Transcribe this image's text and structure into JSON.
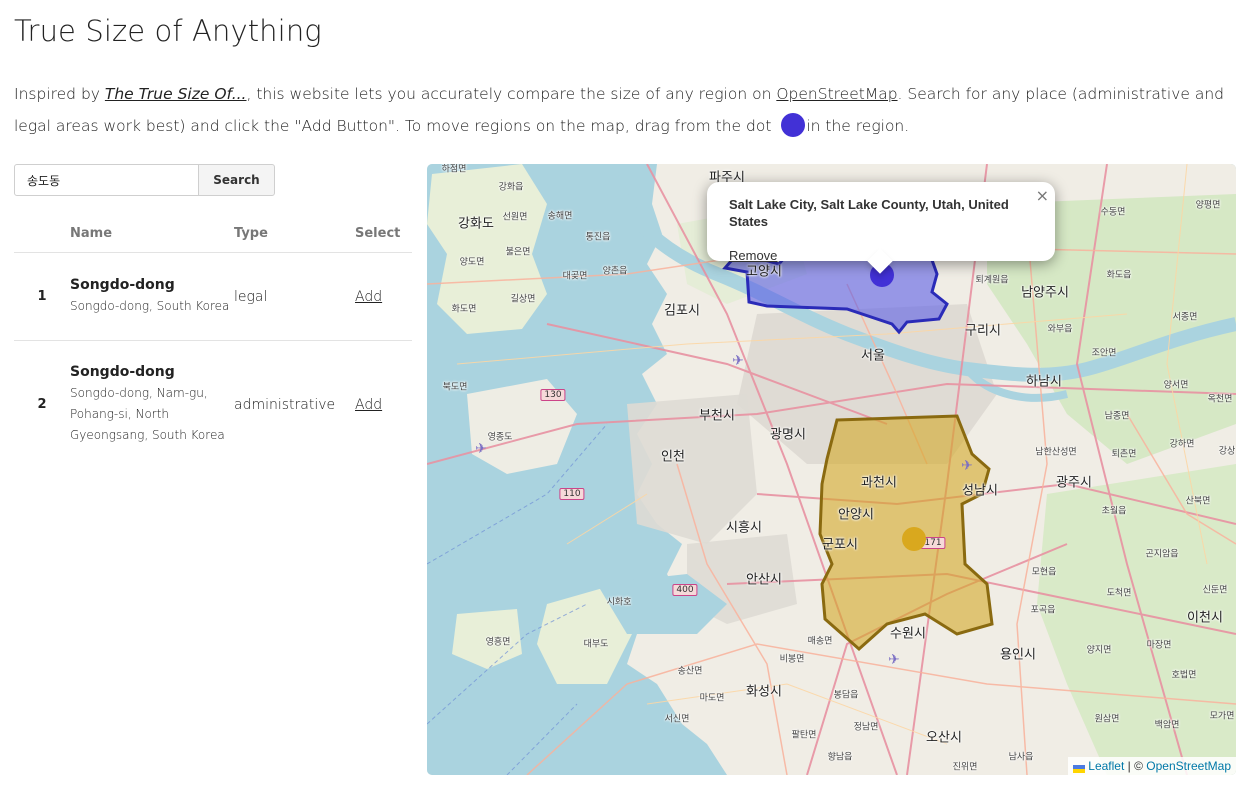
{
  "page": {
    "title": "True Size of Anything",
    "intro": {
      "part1": "Inspired by ",
      "link1": "The True Size Of...",
      "part2": ", this website lets you accurately compare the size of any region on ",
      "link2": "OpenStreetMap",
      "part3": ". Search for any place (administrative and legal areas work best) and click the \"Add Button\". To move regions on the map, drag from the dot ",
      "part4": "in the region."
    },
    "dot_color": "#4231d6"
  },
  "search": {
    "value": "송도동",
    "button_label": "Search"
  },
  "results": {
    "headers": [
      "",
      "Name",
      "Type",
      "Select"
    ],
    "rows": [
      {
        "index": "1",
        "name": "Songdo-dong",
        "description": "Songdo-dong, South Korea",
        "type": "legal",
        "action": "Add"
      },
      {
        "index": "2",
        "name": "Songdo-dong",
        "description": "Songdo-dong, Nam-gu, Pohang-si, North Gyeongsang, South Korea",
        "type": "administrative",
        "action": "Add"
      }
    ]
  },
  "map": {
    "popup": {
      "title": "Salt Lake City, Salt Lake County, Utah, United States",
      "remove_label": "Remove",
      "close_symbol": "×"
    },
    "regions": [
      {
        "name": "Salt Lake City",
        "fill": "#5b5ee6",
        "stroke": "#2a2bb8"
      },
      {
        "name": "region-yellow",
        "fill": "#d4a928",
        "stroke": "#8a6a10"
      }
    ],
    "labels": {
      "paju": "파주시",
      "goyang": "고양시",
      "gimpo": "김포시",
      "seoul": "서울",
      "guri": "구리시",
      "namyangju": "남양주시",
      "hanam": "하남시",
      "bucheon": "부천시",
      "gwangmyeong": "광명시",
      "incheon": "인천",
      "gwacheon": "과천시",
      "seongnam": "성남시",
      "gwangju": "광주시",
      "anyang": "안양시",
      "gunpo": "군포시",
      "siheung": "시흥시",
      "ansan": "안산시",
      "suwon": "수원시",
      "yongin": "용인시",
      "icheon": "이천시",
      "hwaseong": "화성시",
      "osan": "오산시",
      "ganghwa": "강화도",
      "sihwaho": "시화호",
      "daebu": "대부도",
      "ansan2": "안산시",
      "yeongjong": "영종도"
    },
    "small_labels": {
      "l1": "하점면",
      "l2": "강화읍",
      "l3": "선원면",
      "l4": "송해면",
      "l5": "통진읍",
      "l6": "양도면",
      "l7": "불은면",
      "l8": "대곶면",
      "l9": "양촌읍",
      "l10": "길상면",
      "l11": "화도면",
      "l12": "북도면",
      "l13": "영흥면",
      "l14": "송산면",
      "l15": "마도면",
      "l16": "서신면",
      "l17": "봉담읍",
      "l18": "정남면",
      "l19": "팔탄면",
      "l20": "향남읍",
      "l21": "비봉면",
      "l22": "매송면",
      "l23": "남한산성면",
      "l24": "퇴촌면",
      "l25": "초월읍",
      "l26": "곤지암읍",
      "l27": "도척면",
      "l28": "포곡읍",
      "l29": "모현읍",
      "l30": "양지면",
      "l31": "마장면",
      "l32": "호법면",
      "l33": "백암면",
      "l34": "원삼면",
      "l35": "남사읍",
      "l36": "진위면",
      "l37": "양평면",
      "l38": "수동면",
      "l39": "화도읍",
      "l40": "조안면",
      "l41": "양서면",
      "l42": "서종면",
      "l43": "남종면",
      "l44": "강하면",
      "l45": "산북면",
      "l46": "퇴계원읍",
      "l47": "와부읍",
      "l48": "신둔면",
      "l49": "모가면",
      "l50": "옥천면",
      "l51": "강상"
    },
    "shields": {
      "s1": "130",
      "s2": "110",
      "s3": "400",
      "s4": "171"
    },
    "attribution": {
      "leaflet": "Leaflet",
      "sep": " | © ",
      "osm": "OpenStreetMap"
    }
  }
}
